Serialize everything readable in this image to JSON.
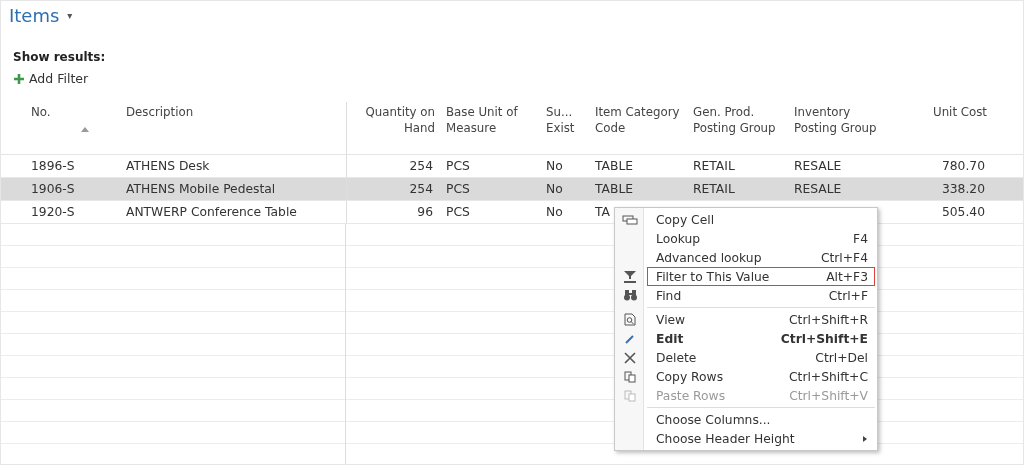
{
  "page": {
    "title": "Items",
    "caret": "▾"
  },
  "filters": {
    "heading": "Show results:",
    "add_filter": "Add Filter"
  },
  "table": {
    "columns": [
      {
        "label": "No.",
        "sorted": true,
        "kind": "text"
      },
      {
        "label": "Description",
        "sorted": false,
        "kind": "text"
      },
      {
        "label": "Quantity on Hand",
        "sorted": false,
        "kind": "number"
      },
      {
        "label": "Base Unit of Measure",
        "sorted": false,
        "kind": "text"
      },
      {
        "label": "Su... Exist",
        "sorted": false,
        "kind": "text"
      },
      {
        "label": "Item Category Code",
        "sorted": false,
        "kind": "text"
      },
      {
        "label": "Gen. Prod. Posting Group",
        "sorted": false,
        "kind": "text"
      },
      {
        "label": "Inventory Posting Group",
        "sorted": false,
        "kind": "text"
      },
      {
        "label": "Unit Cost",
        "sorted": false,
        "kind": "number"
      }
    ],
    "rows": [
      {
        "selected": false,
        "cells": [
          "1896-S",
          "ATHENS Desk",
          "254",
          "PCS",
          "No",
          "TABLE",
          "RETAIL",
          "RESALE",
          "780.70"
        ]
      },
      {
        "selected": true,
        "cells": [
          "1906-S",
          "ATHENS Mobile Pedestal",
          "254",
          "PCS",
          "No",
          "TABLE",
          "RETAIL",
          "RESALE",
          "338.20"
        ]
      },
      {
        "selected": false,
        "cells": [
          "1920-S",
          "ANTWERP Conference Table",
          "96",
          "PCS",
          "No",
          "TA",
          null,
          null,
          "505.40"
        ]
      }
    ]
  },
  "context_menu": {
    "groups": [
      [
        {
          "label": "Copy Cell",
          "disabled": false,
          "emphasized": false,
          "outlined": false,
          "submenu": false
        },
        {
          "label": "Lookup",
          "shortcut": "F4",
          "disabled": false,
          "emphasized": false,
          "outlined": false,
          "submenu": false
        },
        {
          "label": "Advanced lookup",
          "shortcut": "Ctrl+F4",
          "disabled": false,
          "emphasized": false,
          "outlined": false,
          "submenu": false
        },
        {
          "label": "Filter to This Value",
          "shortcut": "Alt+F3",
          "disabled": false,
          "emphasized": false,
          "outlined": true,
          "submenu": false
        },
        {
          "label": "Find",
          "shortcut": "Ctrl+F",
          "disabled": false,
          "emphasized": false,
          "outlined": false,
          "submenu": false
        }
      ],
      [
        {
          "label": "View",
          "shortcut": "Ctrl+Shift+R",
          "disabled": false,
          "emphasized": false,
          "outlined": false,
          "submenu": false
        },
        {
          "label": "Edit",
          "shortcut": "Ctrl+Shift+E",
          "disabled": false,
          "emphasized": true,
          "outlined": false,
          "submenu": false
        },
        {
          "label": "Delete",
          "shortcut": "Ctrl+Del",
          "disabled": false,
          "emphasized": false,
          "outlined": false,
          "submenu": false
        },
        {
          "label": "Copy Rows",
          "shortcut": "Ctrl+Shift+C",
          "disabled": false,
          "emphasized": false,
          "outlined": false,
          "submenu": false
        },
        {
          "label": "Paste Rows",
          "shortcut": "Ctrl+Shift+V",
          "disabled": true,
          "emphasized": false,
          "outlined": false,
          "submenu": false
        }
      ],
      [
        {
          "label": "Choose Columns...",
          "disabled": false,
          "emphasized": false,
          "outlined": false,
          "submenu": false
        },
        {
          "label": "Choose Header Height",
          "disabled": false,
          "emphasized": false,
          "outlined": false,
          "submenu": true
        }
      ]
    ]
  }
}
